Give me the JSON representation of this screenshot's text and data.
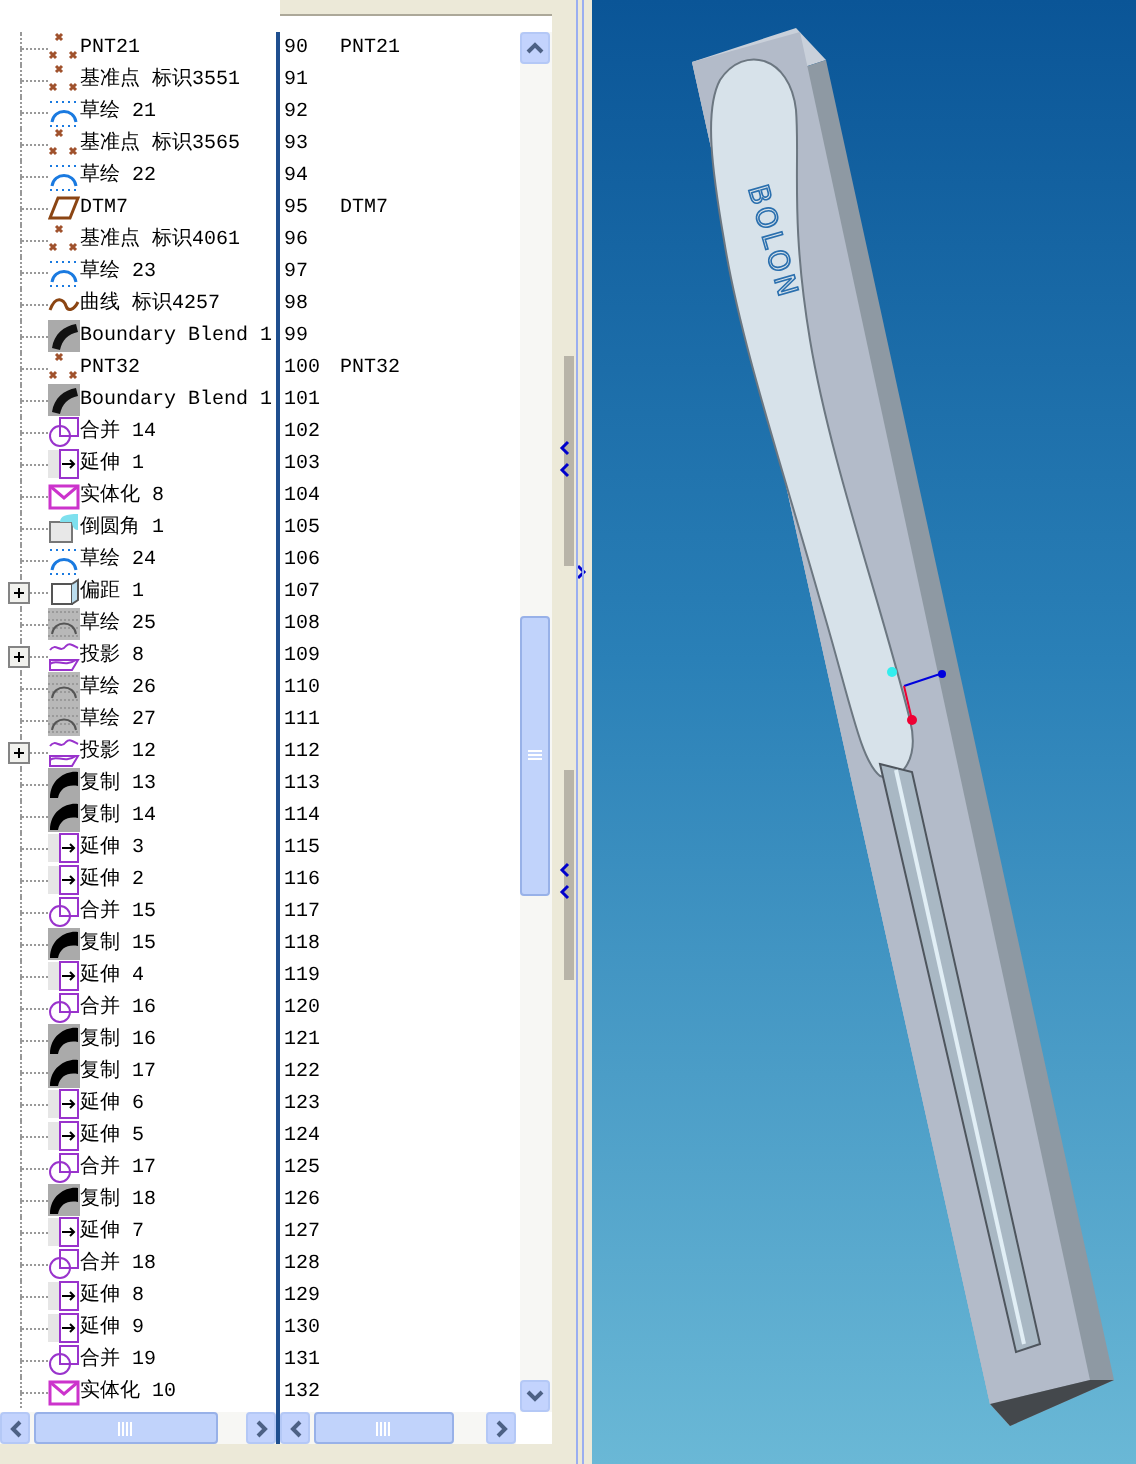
{
  "model_tree": {
    "items": [
      {
        "kind": "point",
        "label": "PNT21",
        "number": "90",
        "feature_name": "PNT21",
        "expandable": false
      },
      {
        "kind": "point",
        "label": "基准点 标识3551",
        "number": "91",
        "expandable": false
      },
      {
        "kind": "sketch",
        "label": "草绘 21",
        "number": "92",
        "expandable": false
      },
      {
        "kind": "point",
        "label": "基准点 标识3565",
        "number": "93",
        "expandable": false
      },
      {
        "kind": "sketch",
        "label": "草绘 22",
        "number": "94",
        "expandable": false
      },
      {
        "kind": "plane",
        "label": "DTM7",
        "number": "95",
        "feature_name": "DTM7",
        "expandable": false
      },
      {
        "kind": "point",
        "label": "基准点 标识4061",
        "number": "96",
        "expandable": false
      },
      {
        "kind": "sketch",
        "label": "草绘 23",
        "number": "97",
        "expandable": false
      },
      {
        "kind": "curve",
        "label": "曲线 标识4257",
        "number": "98",
        "expandable": false
      },
      {
        "kind": "blend",
        "label": "Boundary Blend 1",
        "number": "99",
        "expandable": false
      },
      {
        "kind": "point",
        "label": "PNT32",
        "number": "100",
        "feature_name": "PNT32",
        "expandable": false
      },
      {
        "kind": "blend",
        "label": "Boundary Blend 1",
        "number": "101",
        "expandable": false
      },
      {
        "kind": "merge",
        "label": "合并 14",
        "number": "102",
        "expandable": false
      },
      {
        "kind": "extend",
        "label": "延伸 1",
        "number": "103",
        "expandable": false
      },
      {
        "kind": "solidify",
        "label": "实体化 8",
        "number": "104",
        "expandable": false
      },
      {
        "kind": "round",
        "label": "倒圆角 1",
        "number": "105",
        "expandable": false
      },
      {
        "kind": "sketch",
        "label": "草绘 24",
        "number": "106",
        "expandable": false
      },
      {
        "kind": "offset",
        "label": "偏距 1",
        "number": "107",
        "expandable": true
      },
      {
        "kind": "sketch_hidden",
        "label": "草绘 25",
        "number": "108",
        "expandable": false
      },
      {
        "kind": "project",
        "label": "投影 8",
        "number": "109",
        "expandable": true
      },
      {
        "kind": "sketch_hidden",
        "label": "草绘 26",
        "number": "110",
        "expandable": false
      },
      {
        "kind": "sketch_hidden",
        "label": "草绘 27",
        "number": "111",
        "expandable": false
      },
      {
        "kind": "project",
        "label": "投影 12",
        "number": "112",
        "expandable": true
      },
      {
        "kind": "copy",
        "label": "复制 13",
        "number": "113",
        "expandable": false
      },
      {
        "kind": "copy",
        "label": "复制 14",
        "number": "114",
        "expandable": false
      },
      {
        "kind": "extend",
        "label": "延伸 3",
        "number": "115",
        "expandable": false
      },
      {
        "kind": "extend",
        "label": "延伸 2",
        "number": "116",
        "expandable": false
      },
      {
        "kind": "merge",
        "label": "合并 15",
        "number": "117",
        "expandable": false
      },
      {
        "kind": "copy",
        "label": "复制 15",
        "number": "118",
        "expandable": false
      },
      {
        "kind": "extend",
        "label": "延伸 4",
        "number": "119",
        "expandable": false
      },
      {
        "kind": "merge",
        "label": "合并 16",
        "number": "120",
        "expandable": false
      },
      {
        "kind": "copy",
        "label": "复制 16",
        "number": "121",
        "expandable": false
      },
      {
        "kind": "copy",
        "label": "复制 17",
        "number": "122",
        "expandable": false
      },
      {
        "kind": "extend",
        "label": "延伸 6",
        "number": "123",
        "expandable": false
      },
      {
        "kind": "extend",
        "label": "延伸 5",
        "number": "124",
        "expandable": false
      },
      {
        "kind": "merge",
        "label": "合并 17",
        "number": "125",
        "expandable": false
      },
      {
        "kind": "copy",
        "label": "复制 18",
        "number": "126",
        "expandable": false
      },
      {
        "kind": "extend",
        "label": "延伸 7",
        "number": "127",
        "expandable": false
      },
      {
        "kind": "merge",
        "label": "合并 18",
        "number": "128",
        "expandable": false
      },
      {
        "kind": "extend",
        "label": "延伸 8",
        "number": "129",
        "expandable": false
      },
      {
        "kind": "extend",
        "label": "延伸 9",
        "number": "130",
        "expandable": false
      },
      {
        "kind": "merge",
        "label": "合并 19",
        "number": "131",
        "expandable": false
      },
      {
        "kind": "solidify",
        "label": "实体化 10",
        "number": "132",
        "expandable": false
      }
    ]
  },
  "viewport": {
    "model_label": "BOLON"
  }
}
